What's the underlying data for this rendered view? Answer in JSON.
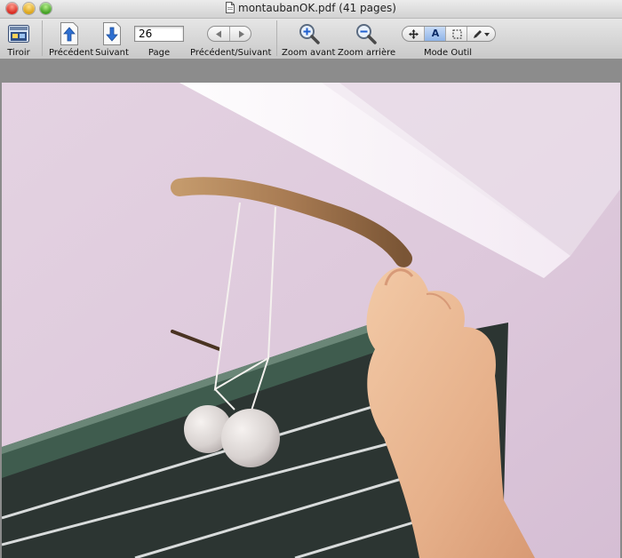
{
  "window": {
    "title": "montaubanOK.pdf (41 pages)"
  },
  "toolbar": {
    "drawer_label": "Tiroir",
    "previous_label": "Précédent",
    "next_label": "Suivant",
    "page_label": "Page",
    "page_value": "26",
    "back_forward_label": "Précédent/Suivant",
    "zoom_in_label": "Zoom avant",
    "zoom_out_label": "Zoom arrière",
    "tool_mode_label": "Mode Outil",
    "tool_mode_selected": "A"
  },
  "icons": {
    "drawer": "drawer-icon",
    "previous": "arrow-up-icon",
    "next": "arrow-down-icon",
    "back": "triangle-left-icon",
    "forward": "triangle-right-icon",
    "zoom_in": "magnifier-plus-icon",
    "zoom_out": "magnifier-minus-icon",
    "move": "move-icon",
    "text": "text-select-icon",
    "select": "marquee-icon",
    "annotate": "pencil-icon"
  }
}
